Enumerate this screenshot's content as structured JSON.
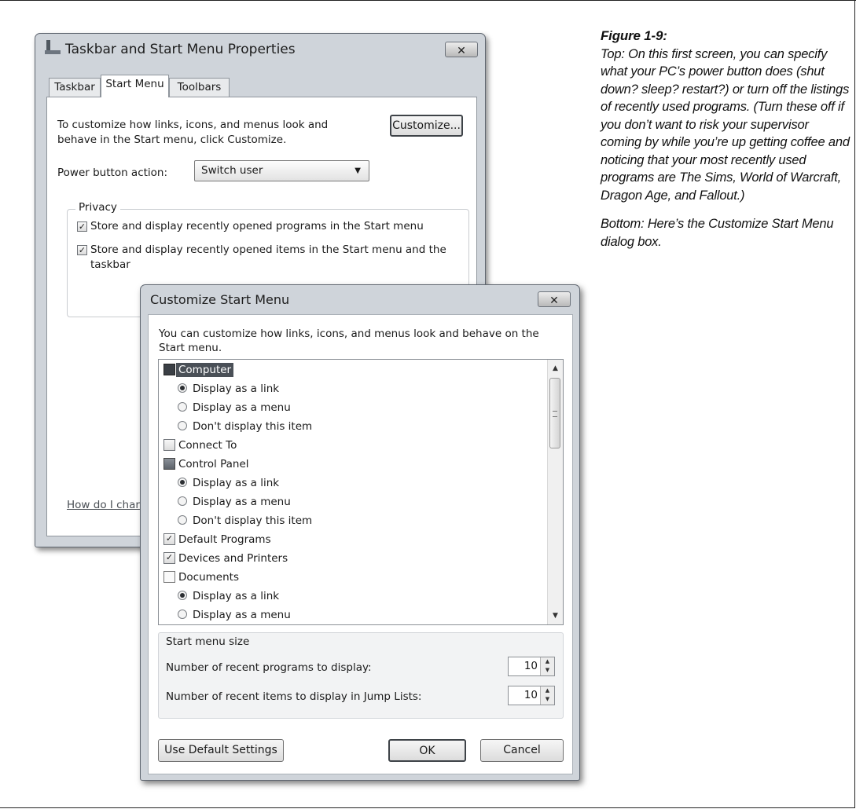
{
  "caption": {
    "figure_label": "Figure 1-9:",
    "top_text": "Top: On this first screen, you can specify what your PC’s power button does (shut down? sleep? restart?) or turn off the listings of recently used programs. (Turn these off if you don’t want to risk your supervisor coming by while you’re up getting coffee and noticing that your most recently used programs are The Sims, World of Warcraft, Dragon Age, and Fallout.)",
    "bottom_text": "Bottom: Here’s the Customize Start Menu dialog box."
  },
  "taskbar_dialog": {
    "title": "Taskbar and Start Menu Properties",
    "close_label": "✕",
    "tabs": [
      {
        "label": "Taskbar"
      },
      {
        "label": "Start Menu",
        "active": true
      },
      {
        "label": "Toolbars"
      }
    ],
    "description": "To customize how links, icons, and menus look and behave in the Start menu, click Customize.",
    "customize_button": "Customize...",
    "power_button_label": "Power button action:",
    "power_button_value": "Switch user",
    "privacy": {
      "label": "Privacy",
      "items": [
        {
          "label": "Store and display recently opened programs in the Start menu",
          "checked": true
        },
        {
          "label": "Store and display recently opened items in the Start menu and the taskbar",
          "checked": true
        }
      ]
    },
    "help_link": "How do I char"
  },
  "customize_dialog": {
    "title": "Customize Start Menu",
    "close_label": "✕",
    "description": "You can customize how links, icons, and menus look and behave on the Start menu.",
    "list_items": [
      {
        "kind": "header",
        "icon": "computer-icon",
        "label": "Computer",
        "selected": true
      },
      {
        "kind": "radio",
        "label": "Display as a link",
        "checked": true
      },
      {
        "kind": "radio",
        "label": "Display as a menu",
        "checked": false
      },
      {
        "kind": "radio",
        "label": "Don't display this item",
        "checked": false
      },
      {
        "kind": "check",
        "label": "Connect To",
        "checked": false
      },
      {
        "kind": "header",
        "icon": "control-panel-icon",
        "label": "Control Panel"
      },
      {
        "kind": "radio",
        "label": "Display as a link",
        "checked": true
      },
      {
        "kind": "radio",
        "label": "Display as a menu",
        "checked": false
      },
      {
        "kind": "radio",
        "label": "Don't display this item",
        "checked": false
      },
      {
        "kind": "check",
        "label": "Default Programs",
        "checked": true
      },
      {
        "kind": "check",
        "label": "Devices and Printers",
        "checked": true
      },
      {
        "kind": "header",
        "icon": "documents-icon",
        "label": "Documents"
      },
      {
        "kind": "radio",
        "label": "Display as a link",
        "checked": true
      },
      {
        "kind": "radio",
        "label": "Display as a menu",
        "checked": false
      }
    ],
    "start_menu_size": {
      "label": "Start menu size",
      "recent_programs_label": "Number of recent programs to display:",
      "recent_programs_value": "10",
      "jump_list_label": "Number of recent items to display in Jump Lists:",
      "jump_list_value": "10"
    },
    "buttons": {
      "use_defaults": "Use Default Settings",
      "ok": "OK",
      "cancel": "Cancel"
    }
  }
}
